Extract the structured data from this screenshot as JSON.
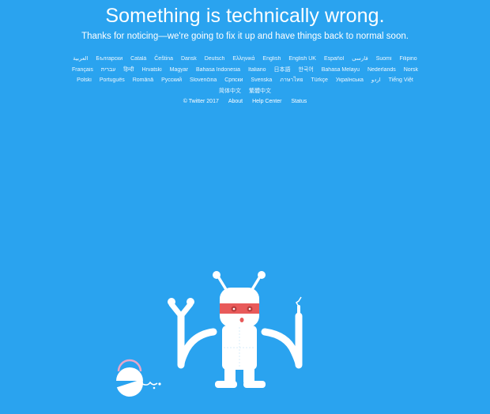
{
  "error": {
    "title": "Something is technically wrong.",
    "message": "Thanks for noticing—we're going to fix it up and have things back to normal soon."
  },
  "languages": {
    "row1": [
      "العربية",
      "Български",
      "Català",
      "Čeština",
      "Dansk",
      "Deutsch",
      "Ελληνικά",
      "English",
      "English UK",
      "Español",
      "فارسی",
      "Suomi",
      "Filipino"
    ],
    "row2": [
      "Français",
      "עברית",
      "हिन्दी",
      "Hrvatski",
      "Magyar",
      "Bahasa Indonesia",
      "Italiano",
      "日本語",
      "한국어",
      "Bahasa Melayu",
      "Nederlands",
      "Norsk"
    ],
    "row3": [
      "Polski",
      "Português",
      "Română",
      "Русский",
      "Slovenčina",
      "Српски",
      "Svenska",
      "ภาษาไทย",
      "Türkçe",
      "Українська",
      "اردو",
      "Tiếng Việt"
    ],
    "row4": [
      "简体中文",
      "繁體中文"
    ]
  },
  "footer": {
    "copyright": "© Twitter 2017",
    "about": "About",
    "help": "Help Center",
    "status": "Status"
  },
  "colors": {
    "background": "#2aa3ef",
    "robot_body": "#ffffff",
    "visor": "#e85a5a"
  },
  "illustration": {
    "icon": "broken-robot-icon"
  }
}
